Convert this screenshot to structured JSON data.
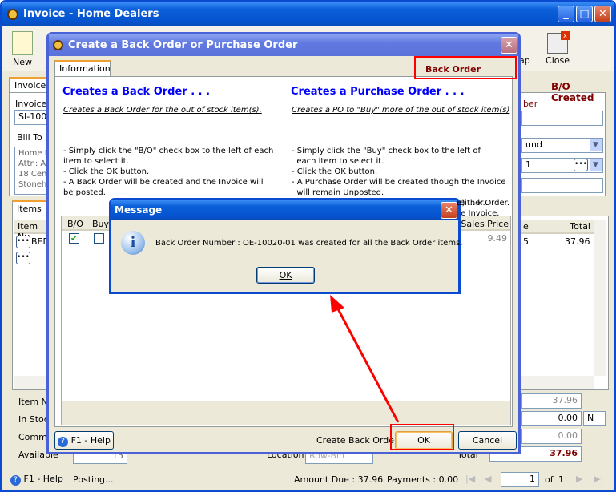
{
  "main_window": {
    "title": "Invoice - Home Dealers",
    "toolbar": {
      "new": "New",
      "map_partial": "ap",
      "close": "Close"
    },
    "status_label": "B/O Created",
    "invoice_tab": "Invoice",
    "invoice_number_label": "Invoice N",
    "invoice_number": "SI-1002",
    "bill_to_label": "Bill To",
    "address": [
      "Home De",
      "Attn: An",
      "18 Cent",
      "Stoneha"
    ],
    "right_label_partial": "ber",
    "right_dropdown_partial": "und",
    "right_field_partial": "1",
    "items_tab": "Items (1",
    "items_table": {
      "headers": [
        "Item Nu",
        "e",
        "Total"
      ],
      "rows": [
        {
          "item": "BED-",
          "price_partial": "5",
          "total": "37.96"
        }
      ]
    },
    "bottom": {
      "item_number_label": "Item Nu",
      "in_stock_label": "In Stock",
      "committed_label": "Committ",
      "available_label": "Available",
      "available_value": "15",
      "location_label": "Location",
      "location_value": "Row-Bin",
      "total_label": "Total",
      "amount1": "37.96",
      "amount2": "0.00",
      "amount2_unit": "N",
      "amount3": "0.00",
      "total_value": "37.96"
    },
    "statusbar": {
      "help": "F1 - Help",
      "status": "Posting...",
      "amount_due": "Amount Due : 37.96",
      "payments": "Payments : 0.00",
      "page": "1",
      "of": "of",
      "pages": "1"
    }
  },
  "bo_dialog": {
    "title": "Create a Back Order or Purchase Order",
    "tab": "Information",
    "status": "Back Order Created",
    "left": {
      "heading": "Creates a Back Order . . .",
      "subheading": "Creates a Back Order for the out of stock item(s).",
      "lines": [
        "- Simply click the \"B/O\" check box to the left of each",
        "item to select it.",
        "- Click the OK button.",
        "- A Back Order will be created and the Invoice will",
        "be posted."
      ]
    },
    "right": {
      "heading": "Creates a Purchase Order . . .",
      "subheading": "Creates a PO to \"Buy\" more of the out of stock item(s)",
      "lines": [
        "- Simply click the \"Buy\" check box to the left of",
        "  each item to select it.",
        "- Click the OK button.",
        "- A Purchase Order will be created though the Invoice",
        "  will remain Unposted.",
        "- Click the \"Post\" button a second time to either...",
        "   A) Create a Back Order and then post the Invoice.",
        "   B) ... k Order."
      ]
    },
    "table": {
      "headers": [
        "B/O",
        "Buy",
        "Sales Price"
      ],
      "rows": [
        {
          "bo": true,
          "buy": false,
          "sales_price": "9.49"
        }
      ]
    },
    "help": "F1 - Help",
    "action_label": "Create Back Order",
    "ok": "OK",
    "cancel": "Cancel"
  },
  "message_box": {
    "title": "Message",
    "text": "Back Order Number : OE-10020-01 was created for all the Back Order items.",
    "ok": "OK",
    "icon": "info-icon"
  },
  "colors": {
    "title_blue": "#0a5fd8",
    "heading_blue": "#0000ff",
    "status_red": "#800000",
    "annotation": "#ff0000"
  }
}
